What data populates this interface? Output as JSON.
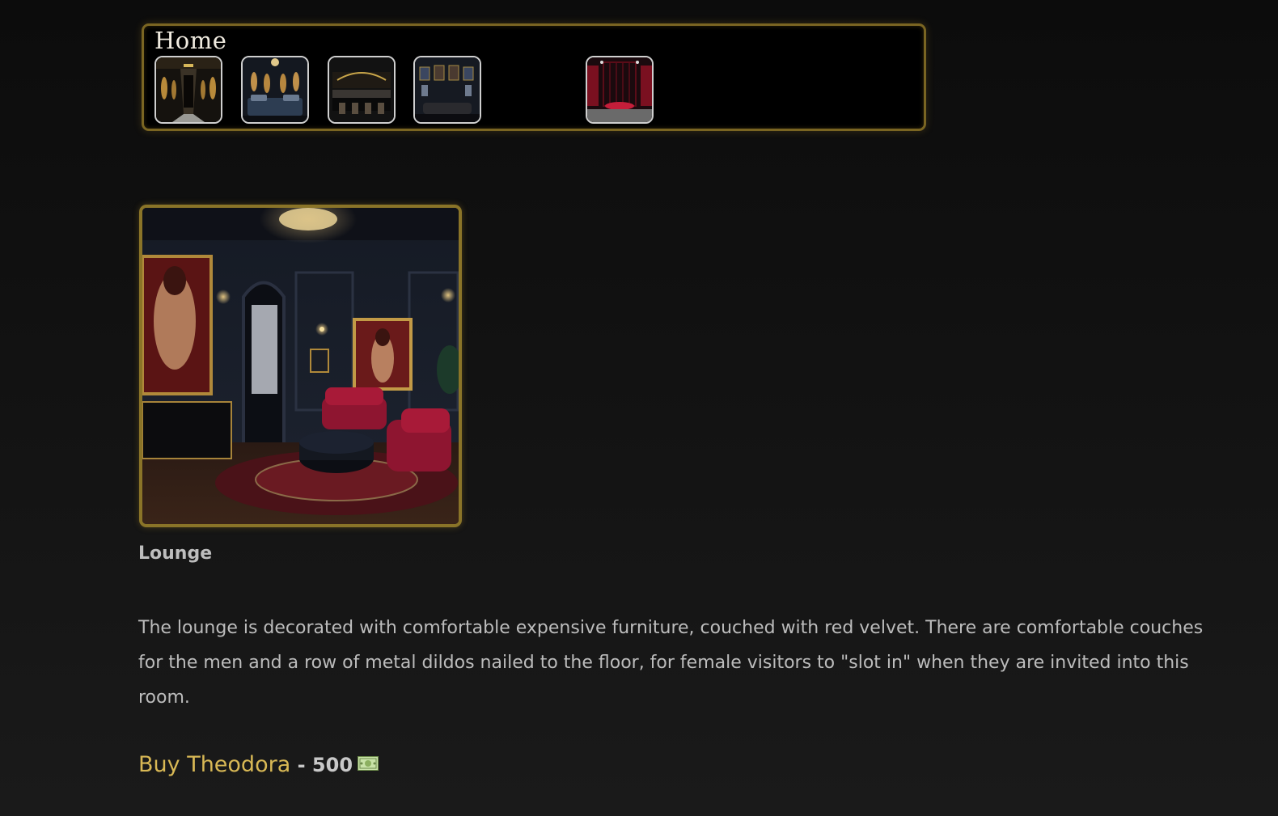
{
  "nav": {
    "title": "Home",
    "thumbnails": [
      {
        "name": "gallery-hall"
      },
      {
        "name": "bedroom"
      },
      {
        "name": "bar"
      },
      {
        "name": "gallery-lounge"
      },
      {
        "name": "red-cage-room"
      }
    ]
  },
  "room": {
    "image_alt": "Lounge",
    "name": "Lounge",
    "description": "The lounge is decorated with comfortable expensive furniture, couched with red velvet. There are comfortable couches for the men and a row of metal dildos nailed to the floor, for female visitors to \"slot in\" when they are invited into this room."
  },
  "buy": {
    "link_label": "Buy Theodora",
    "separator": " - ",
    "price": "500",
    "currency_icon": "money-icon"
  },
  "colors": {
    "accent_gold": "#d8b855",
    "frame_gold": "#8a7428",
    "velvet_red": "#8e1530"
  }
}
